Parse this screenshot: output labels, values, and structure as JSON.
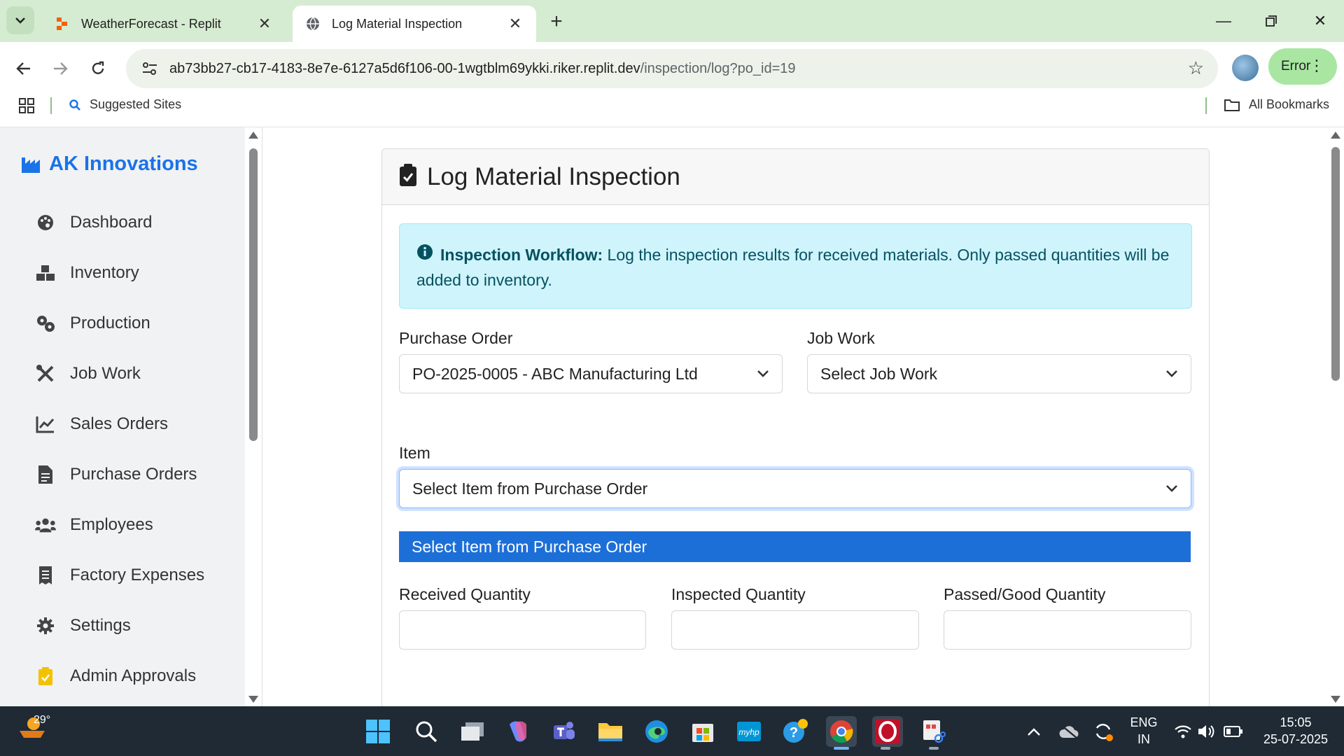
{
  "browser": {
    "tabs": [
      {
        "title": "WeatherForecast - Replit",
        "active": false
      },
      {
        "title": "Log Material Inspection",
        "active": true
      }
    ],
    "url_host": "ab73bb27-cb17-4183-8e7e-6127a5d6f106-00-1wgtblm69ykki.riker.replit.dev",
    "url_path": "/inspection/log?po_id=19",
    "profile_status": "Error",
    "bookmarks": {
      "suggested": "Suggested Sites",
      "all": "All Bookmarks"
    }
  },
  "sidebar": {
    "brand": "AK Innovations",
    "items": [
      {
        "label": "Dashboard",
        "icon": "palette-icon"
      },
      {
        "label": "Inventory",
        "icon": "boxes-icon"
      },
      {
        "label": "Production",
        "icon": "gears-icon"
      },
      {
        "label": "Job Work",
        "icon": "tools-icon"
      },
      {
        "label": "Sales Orders",
        "icon": "chart-line-icon"
      },
      {
        "label": "Purchase Orders",
        "icon": "file-invoice-icon"
      },
      {
        "label": "Employees",
        "icon": "users-icon"
      },
      {
        "label": "Factory Expenses",
        "icon": "receipt-icon"
      },
      {
        "label": "Settings",
        "icon": "gear-icon"
      },
      {
        "label": "Admin Approvals",
        "icon": "clipboard-check-icon"
      }
    ]
  },
  "page": {
    "title": "Log Material Inspection",
    "alert": {
      "heading": "Inspection Workflow:",
      "text": " Log the inspection results for received materials. Only passed quantities will be added to inventory."
    },
    "form": {
      "purchase_order": {
        "label": "Purchase Order",
        "value": "PO-2025-0005 - ABC Manufacturing Ltd"
      },
      "job_work": {
        "label": "Job Work",
        "value": "Select Job Work"
      },
      "item": {
        "label": "Item",
        "value": "Select Item from Purchase Order",
        "options": [
          "Select Item from Purchase Order"
        ]
      },
      "received_quantity": {
        "label": "Received Quantity",
        "value": ""
      },
      "inspected_quantity": {
        "label": "Inspected Quantity",
        "value": ""
      },
      "passed_quantity": {
        "label": "Passed/Good Quantity",
        "value": ""
      }
    }
  },
  "taskbar": {
    "temperature": "29°",
    "language": "ENG",
    "region": "IN",
    "time": "15:05",
    "date": "25-07-2025"
  },
  "colors": {
    "brand": "#1a73e8",
    "alert_bg": "#cff4fc",
    "alert_text": "#055160",
    "dropdown_highlight": "#1d6fd8",
    "tabstrip": "#d6ecd2"
  }
}
